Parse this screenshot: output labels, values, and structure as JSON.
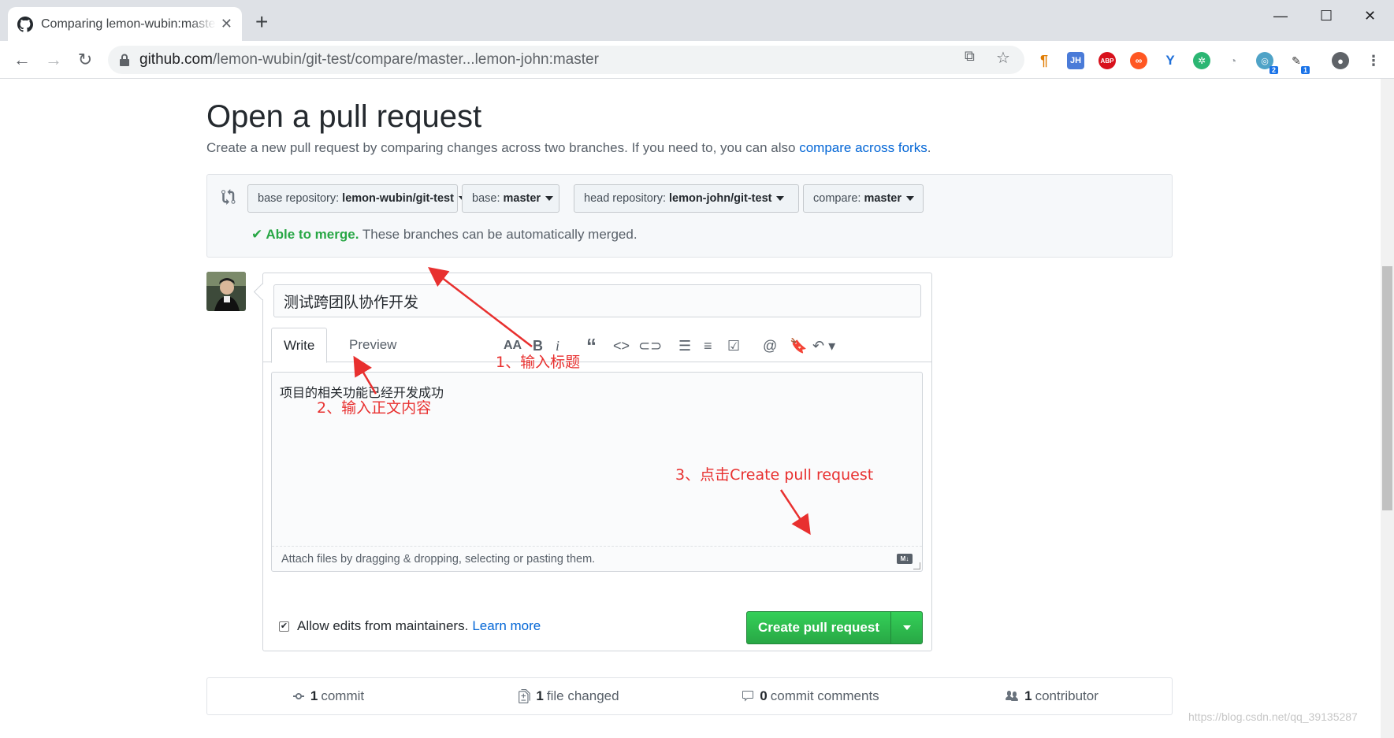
{
  "browser": {
    "tab_title": "Comparing lemon-wubin:master...lemon-john:master",
    "url_host": "github.com",
    "url_path": "/lemon-wubin/git-test/compare/master...lemon-john:master",
    "extension_badges": [
      "2",
      "1"
    ]
  },
  "header": {
    "title": "Open a pull request",
    "subtitle_prefix": "Create a new pull request by comparing changes across two branches. If you need to, you can also ",
    "subtitle_link": "compare across forks",
    "subtitle_suffix": "."
  },
  "range": {
    "base_repo_label": "base repository:",
    "base_repo_value": "lemon-wubin/git-test",
    "base_label": "base:",
    "base_value": "master",
    "head_repo_label": "head repository:",
    "head_repo_value": "lemon-john/git-test",
    "compare_label": "compare:",
    "compare_value": "master",
    "merge_status": "Able to merge.",
    "merge_detail": " These branches can be automatically merged."
  },
  "form": {
    "title_value": "测试跨团队协作开发",
    "tab_write": "Write",
    "tab_preview": "Preview",
    "body_value": "项目的相关功能已经开发成功",
    "attach_hint": "Attach files by dragging & dropping, selecting or pasting them.",
    "md_badge": "M↓",
    "allow_edits_label": "Allow edits from maintainers.",
    "learn_more": "Learn more",
    "allow_edits_checked": true,
    "submit_label": "Create pull request"
  },
  "summary": {
    "commits_count": "1",
    "commits_label": "commit",
    "files_count": "1",
    "files_label": "file changed",
    "comments_count": "0",
    "comments_label": "commit comments",
    "contributors_count": "1",
    "contributors_label": "contributor"
  },
  "annotations": {
    "step1": "1、输入标题",
    "step2": "2、输入正文内容",
    "step3": "3、点击Create pull request",
    "color": "#e8302f"
  },
  "watermark": "https://blog.csdn.net/qq_39135287",
  "colors": {
    "primary_button": "#28a745",
    "link": "#0366d6",
    "annotation": "#e8302f"
  }
}
